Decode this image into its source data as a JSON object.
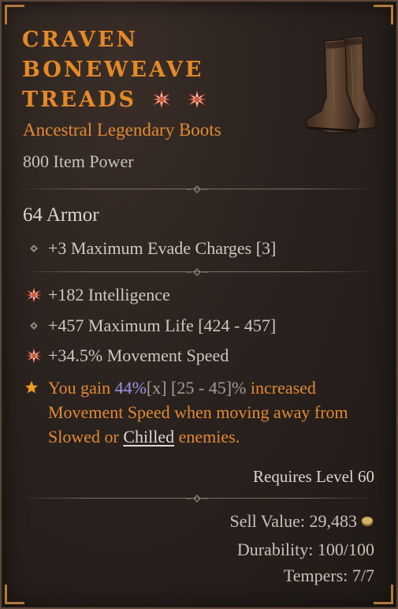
{
  "item": {
    "name_line1": "CRAVEN",
    "name_line2": "BONEWEAVE",
    "name_line3": "TREADS",
    "type": "Ancestral Legendary Boots",
    "item_power": "800 Item Power",
    "armor": "64 Armor",
    "implicit": "+3 Maximum Evade Charges [3]",
    "affixes": [
      {
        "text": "+182 Intelligence",
        "bullet": "greater-affix-star-icon"
      },
      {
        "text": "+457 Maximum Life [424 - 457]",
        "bullet": "diamond-bullet-icon"
      },
      {
        "text": "+34.5% Movement Speed",
        "bullet": "greater-affix-star-icon"
      }
    ],
    "legendary_aspect": {
      "prefix": "You gain ",
      "value": "44%",
      "multiplier": "[x]",
      "range": " [25 - 45]%",
      "mid": " increased Movement Speed when moving away from Slowed or ",
      "keyword": "Chilled",
      "suffix": " enemies."
    },
    "requires_level": "Requires Level 60",
    "sell_value": "Sell Value: 29,483",
    "durability": "Durability: 100/100",
    "tempers": "Tempers: 7/7"
  },
  "colors": {
    "legendary_orange": "#e48a27",
    "value_purple": "#9c97e8",
    "frame_gold": "#b07a3a"
  }
}
